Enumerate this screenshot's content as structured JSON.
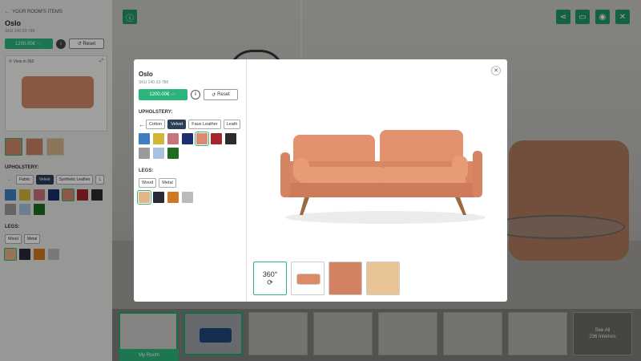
{
  "left_panel": {
    "back_label": "YOUR ROOM'S ITEMS",
    "product_name": "Oslo",
    "sku": "SKU 140-33-786",
    "price": "1200.00€",
    "reset_label": "Reset",
    "view360_label": "View in 360",
    "upholstery_label": "UPHOLSTERY:",
    "upholstery_options": [
      "Fabric",
      "Velvet",
      "Synthetic Leather",
      "L"
    ],
    "legs_label": "LEGS:",
    "legs_options": [
      "Wood",
      "Metal"
    ]
  },
  "modal": {
    "product_name": "Oslo",
    "sku": "SKU 140-33-786",
    "price": "1200.00€",
    "reset_label": "Reset",
    "upholstery_label": "UPHOLSTERY:",
    "upholstery_options": [
      "Cotton",
      "Velvet",
      "Faux Leather",
      "Leath"
    ],
    "selected_upholstery": "Velvet",
    "upholstery_colors": [
      "#3f7fc0",
      "#d1b43a",
      "#c4747a",
      "#1d2f6e",
      "#d98a70",
      "#a2262c",
      "#2b2b2b",
      "#9a9a9a",
      "#a8c2de",
      "#1f6b22"
    ],
    "legs_label": "LEGS:",
    "legs_options": [
      "Wood",
      "Metal"
    ],
    "legs_colors": [
      "#e0b685",
      "#2a2838",
      "#cf7a22",
      "#bbbbbb"
    ],
    "thumb_360_label": "360°"
  },
  "strip": {
    "my_room_label": "My Room",
    "see_all_label": "See All",
    "interiors_count": "236 Interiors"
  },
  "colors": {
    "accent": "#2bb57a",
    "selected_chip": "#2c3e58",
    "sofa": "#dc8b67"
  }
}
